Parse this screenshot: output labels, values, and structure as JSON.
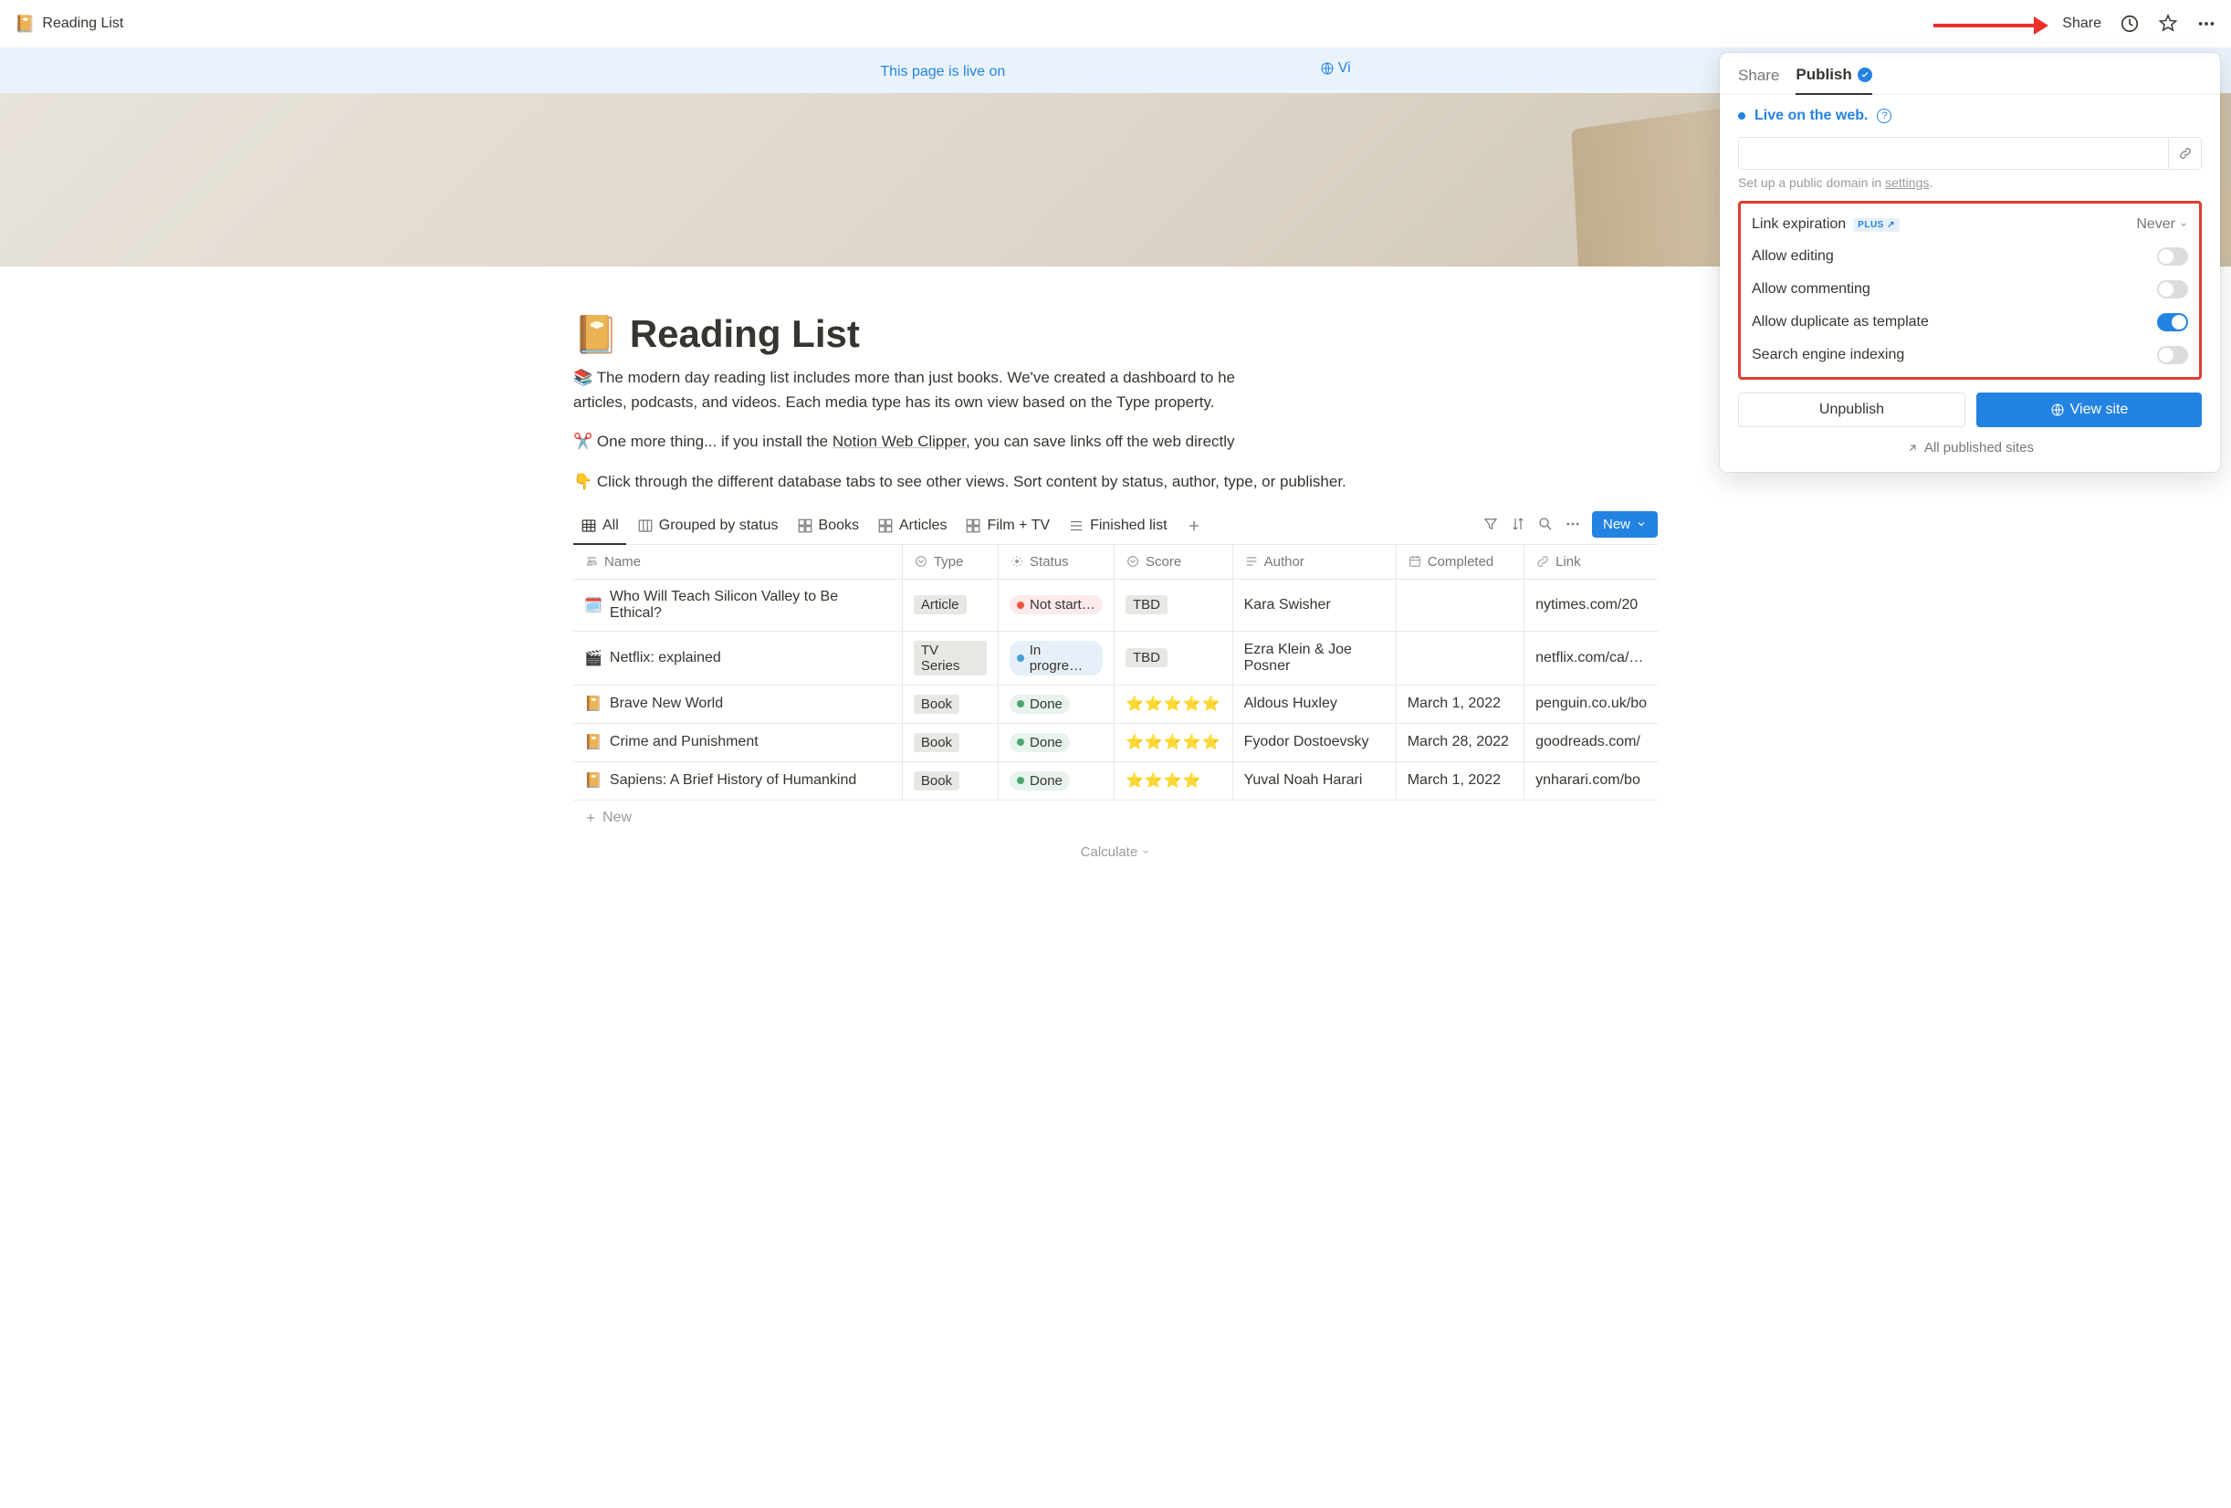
{
  "topbar": {
    "breadcrumb_icon": "📔",
    "breadcrumb_title": "Reading List",
    "share_label": "Share"
  },
  "banner": {
    "text": "This page is live on",
    "view_site": "Vi"
  },
  "page": {
    "icon": "📔",
    "title": "Reading List",
    "desc1_prefix": "📚 The modern day reading list includes more than just books. We've created a dashboard to he",
    "desc1_suffix": "articles, podcasts, and videos. Each media type has its own view based on the Type property.",
    "desc2_prefix": "✂️ One more thing... if you install the ",
    "desc2_link": "Notion Web Clipper",
    "desc2_suffix": ", you can save links off the web directly",
    "desc3": "👇 Click through the different database tabs to see other views. Sort content by status, author, type, or publisher."
  },
  "tabs": {
    "all": "All",
    "grouped": "Grouped by status",
    "books": "Books",
    "articles": "Articles",
    "film": "Film + TV",
    "finished": "Finished list",
    "new_button": "New"
  },
  "columns": {
    "name": "Name",
    "type": "Type",
    "status": "Status",
    "score": "Score",
    "author": "Author",
    "completed": "Completed",
    "link": "Link"
  },
  "rows": [
    {
      "icon": "🗓️",
      "name": "Who Will Teach Silicon Valley to Be Ethical?",
      "type": "Article",
      "status": "Not start…",
      "status_class": "notstarted",
      "score": "TBD",
      "score_pill": true,
      "author": "Kara Swisher",
      "completed": "",
      "link": "nytimes.com/20"
    },
    {
      "icon": "🎬",
      "name": "Netflix: explained",
      "type": "TV Series",
      "status": "In progre…",
      "status_class": "inprogress",
      "score": "TBD",
      "score_pill": true,
      "author": "Ezra Klein & Joe Posner",
      "completed": "",
      "link": "netflix.com/ca/…"
    },
    {
      "icon": "📔",
      "name": "Brave New World",
      "type": "Book",
      "status": "Done",
      "status_class": "done",
      "score": "⭐⭐⭐⭐⭐",
      "score_pill": false,
      "author": "Aldous Huxley",
      "completed": "March 1, 2022",
      "link": "penguin.co.uk/bo"
    },
    {
      "icon": "📔",
      "name": "Crime and Punishment",
      "type": "Book",
      "status": "Done",
      "status_class": "done",
      "score": "⭐⭐⭐⭐⭐",
      "score_pill": false,
      "author": "Fyodor Dostoevsky",
      "completed": "March 28, 2022",
      "link": "goodreads.com/"
    },
    {
      "icon": "📔",
      "name": "Sapiens: A Brief History of Humankind",
      "type": "Book",
      "status": "Done",
      "status_class": "done",
      "score": "⭐⭐⭐⭐",
      "score_pill": false,
      "author": "Yuval Noah Harari",
      "completed": "March 1, 2022",
      "link": "ynharari.com/bo"
    }
  ],
  "new_row": "New",
  "calculate": "Calculate",
  "popover": {
    "tab_share": "Share",
    "tab_publish": "Publish",
    "live_text": "Live on the web.",
    "domain_hint_prefix": "Set up a public domain in ",
    "domain_hint_link": "settings",
    "domain_hint_suffix": ".",
    "link_expiration": "Link expiration",
    "plus_badge": "PLUS",
    "never": "Never",
    "allow_editing": "Allow editing",
    "allow_commenting": "Allow commenting",
    "allow_duplicate": "Allow duplicate as template",
    "search_indexing": "Search engine indexing",
    "toggles": {
      "editing": false,
      "commenting": false,
      "duplicate": true,
      "indexing": false
    },
    "unpublish": "Unpublish",
    "view_site": "View site",
    "all_published": "All published sites"
  }
}
